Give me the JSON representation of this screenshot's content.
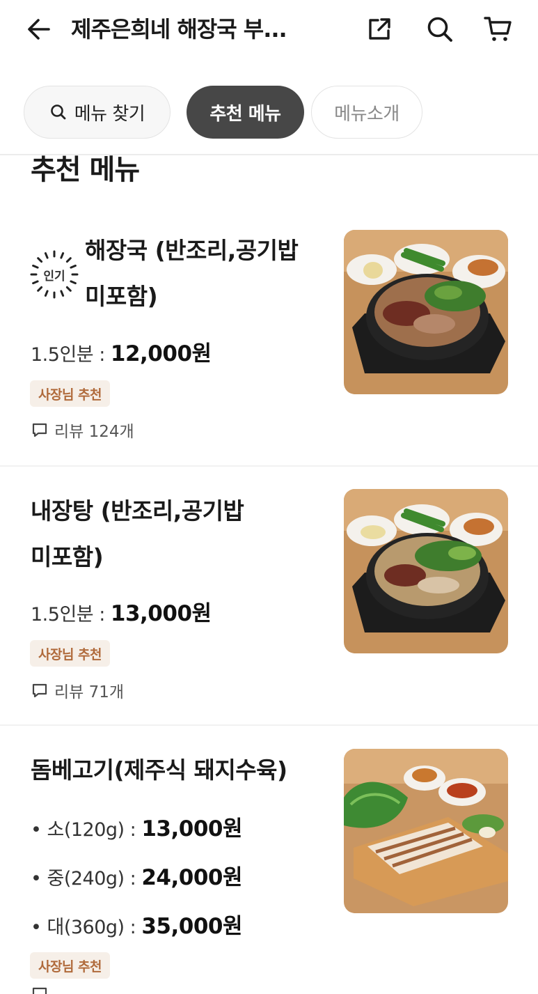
{
  "header": {
    "title": "제주은희네 해장국 부...",
    "icons": [
      "back-arrow-icon",
      "share-icon",
      "search-icon",
      "cart-icon"
    ]
  },
  "tabs": {
    "search_label": "메뉴 찾기",
    "recommended_label": "추천 메뉴",
    "intro_label": "메뉴소개"
  },
  "section": {
    "title": "추천 메뉴"
  },
  "items": [
    {
      "popular_badge": "인기",
      "name_line1": "해장국 (반조리,공기밥",
      "name_line2": "미포함)",
      "price_label": "1.5인분 : ",
      "price": "12,000원",
      "badge": "사장님 추천",
      "review": "리뷰 124개"
    },
    {
      "name_line1": "내장탕 (반조리,공기밥",
      "name_line2": "미포함)",
      "price_label": "1.5인분 : ",
      "price": "13,000원",
      "badge": "사장님 추천",
      "review": "리뷰 71개"
    },
    {
      "name_line1": "돔베고기(제주식 돼지수육)",
      "options": [
        {
          "label": "• 소(120g) : ",
          "price": "13,000원"
        },
        {
          "label": "• 중(240g) : ",
          "price": "24,000원"
        },
        {
          "label": "• 대(360g) : ",
          "price": "35,000원"
        }
      ],
      "badge": "사장님 추천"
    }
  ],
  "colors": {
    "active_tab": "#474747",
    "badge_bg": "#f6efe8",
    "badge_text": "#b06a3b"
  }
}
